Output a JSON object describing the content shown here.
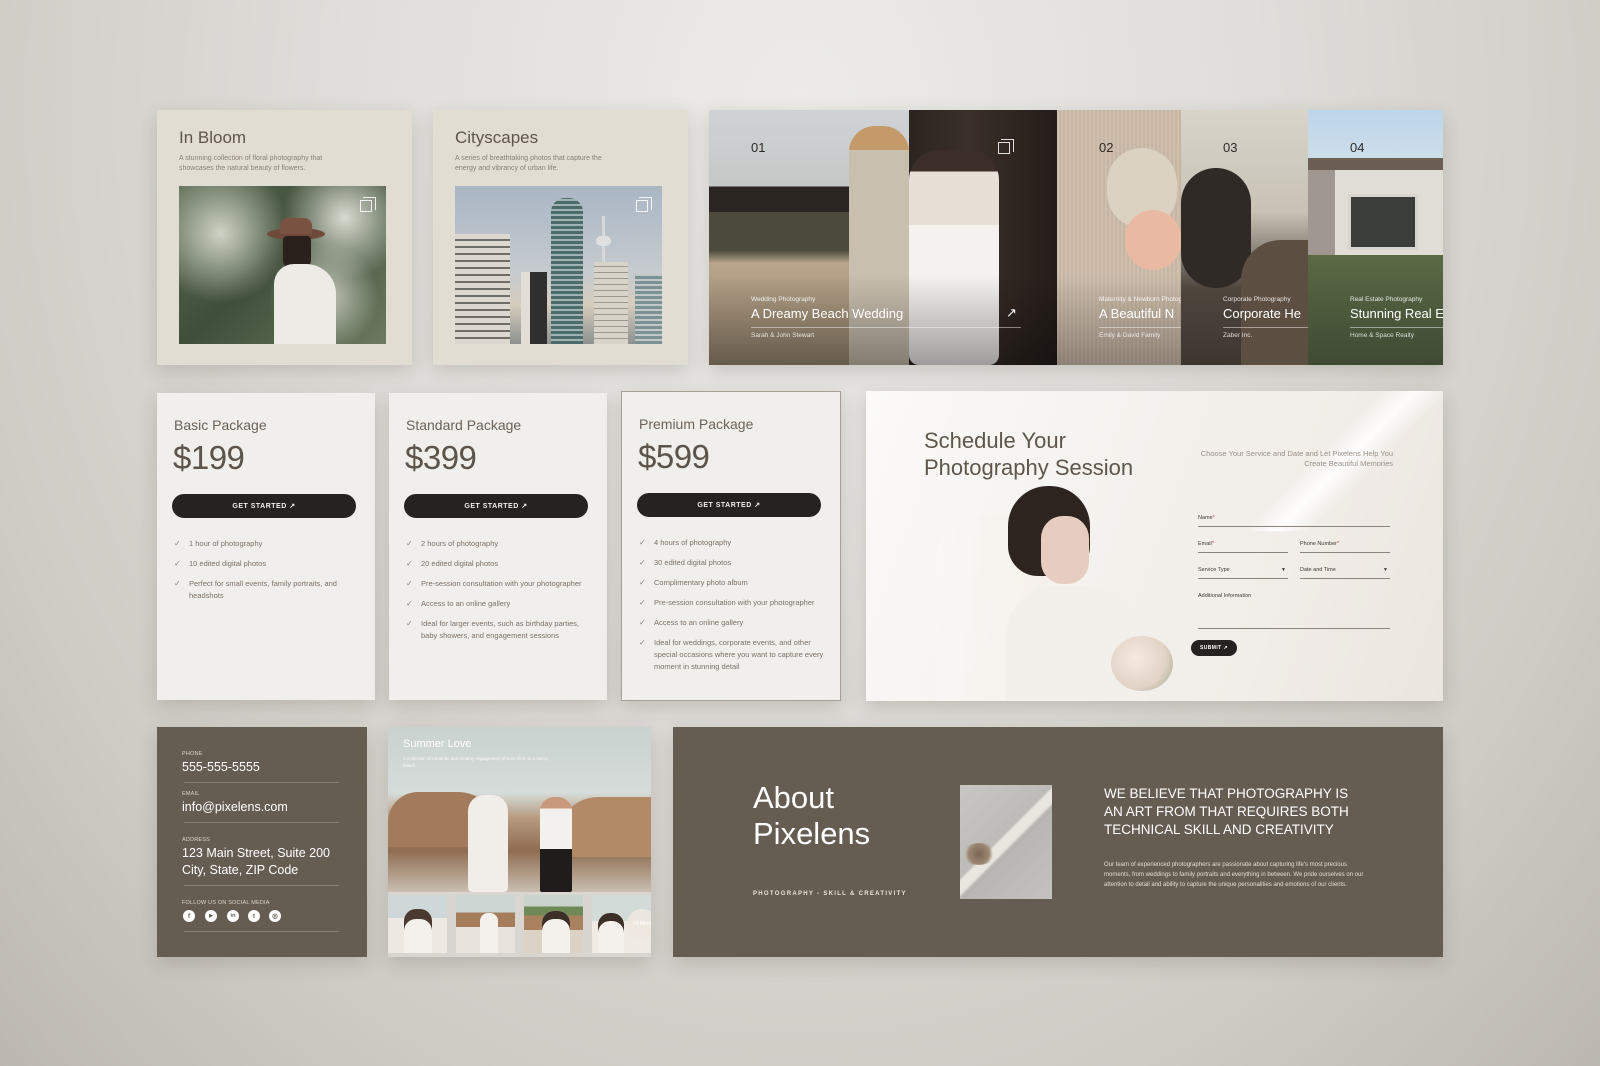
{
  "portfolio": [
    {
      "title": "In Bloom",
      "description": "A stunning collection of floral photography that showcases the natural beauty of flowers.",
      "icon": "gallery-copy-icon"
    },
    {
      "title": "Cityscapes",
      "description": "A series of breathtaking photos that capture the energy and vibrancy of urban life.",
      "icon": "gallery-copy-icon"
    }
  ],
  "carousel": {
    "slides": [
      {
        "number": "01",
        "category": "Wedding Photography",
        "title": "A Dreamy Beach Wedding",
        "client": "Sarah & John Stewart",
        "arrow": "↗"
      },
      {
        "number": "02",
        "category": "Maternity & Newborn Photography",
        "title": "A Beautiful N",
        "client": "Emily & David Family"
      },
      {
        "number": "03",
        "category": "Corporate Photography",
        "title": "Corporate He",
        "client": "Zaber Inc."
      },
      {
        "number": "04",
        "category": "Real Estate Photography",
        "title": "Stunning Real E",
        "client": "Home & Space Realty"
      }
    ]
  },
  "pricing": [
    {
      "name": "Basic Package",
      "price": "$199",
      "button": "GET STARTED ↗",
      "features": [
        "1 hour of photography",
        "10 edited digital photos",
        "Perfect for small events, family portraits, and headshots"
      ]
    },
    {
      "name": "Standard Package",
      "price": "$399",
      "button": "GET STARTED ↗",
      "features": [
        "2 hours of photography",
        "20 edited digital photos",
        "Pre-session consultation with your photographer",
        "Access to an online gallery",
        "Ideal for larger events, such as birthday parties, baby showers, and engagement sessions"
      ]
    },
    {
      "name": "Premium Package",
      "price": "$599",
      "button": "GET STARTED ↗",
      "features": [
        "4 hours of photography",
        "30 edited digital photos",
        "Complimentary photo album",
        "Pre-session consultation with your photographer",
        "Access to an online gallery",
        "Ideal for weddings, corporate events, and other special occasions where you want to capture every moment in stunning detail"
      ]
    }
  ],
  "schedule": {
    "title_line1": "Schedule Your",
    "title_line2": "Photography Session",
    "subtitle": "Choose Your Service and Date and Let Pixelens Help You Create Beautiful Memories",
    "fields": {
      "name": "Name",
      "email": "Email",
      "phone": "Phone Number",
      "service": "Service Type",
      "datetime": "Date and Time",
      "additional": "Additional Information"
    },
    "required_mark": "*",
    "submit": "SUBMIT ↗"
  },
  "contact": {
    "phone_label": "PHONE",
    "phone": "555-555-5555",
    "email_label": "EMAIL",
    "email": "info@pixelens.com",
    "address_label": "ADDRESS",
    "address_line1": "123 Main Street, Suite 200",
    "address_line2": "City, State, ZIP Code",
    "social_label": "FOLLOW US ON SOCIAL MEDIA",
    "social": [
      {
        "name": "facebook",
        "glyph": "f"
      },
      {
        "name": "youtube",
        "glyph": "▶"
      },
      {
        "name": "linkedin",
        "glyph": "in"
      },
      {
        "name": "twitter",
        "glyph": "t"
      },
      {
        "name": "instagram",
        "glyph": "◎"
      }
    ]
  },
  "gallery": {
    "title": "Summer Love",
    "description": "A collection of romantic and dreamy engagement photos shot on a sunny beach.",
    "more": "+3 More"
  },
  "about": {
    "title_line1": "About",
    "title_line2": "Pixelens",
    "tagline": "PHOTOGRAPHY - SKILL & CREATIVITY",
    "heading": "We believe that photography is an art from that requires both technical skill and creativity",
    "body": "Our team of experienced photographers are passionate about capturing life's most precious moments, from weddings to family portraits and everything in between. We pride ourselves on our attention to detail and ability to capture the unique personalities and emotions of our clients."
  },
  "colors": {
    "brown": "#665d52",
    "beige": "#e1ddd3",
    "cream": "#f1efeb",
    "dark": "#252321"
  }
}
